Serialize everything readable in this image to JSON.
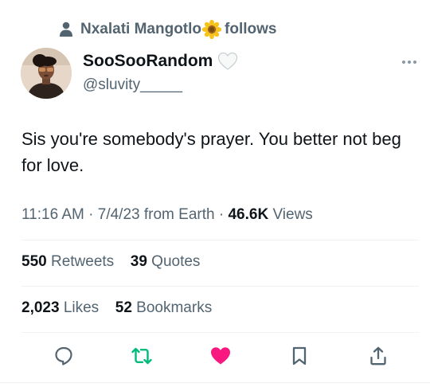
{
  "social_context": {
    "user_name": "Nxalati Mangotlo",
    "action": "follows",
    "icon": "person-icon",
    "emoji": "sunflower"
  },
  "author": {
    "display_name": "SooSooRandom",
    "handle": "@sluvity_____",
    "badge": "white-heart"
  },
  "tweet": {
    "text": "Sis you're somebody's prayer. You better not beg for love."
  },
  "meta": {
    "time": "11:16 AM",
    "date": "7/4/23",
    "source": "from Earth",
    "views_count": "46.6K",
    "views_label": "Views"
  },
  "stats": {
    "retweets_count": "550",
    "retweets_label": "Retweets",
    "quotes_count": "39",
    "quotes_label": "Quotes",
    "likes_count": "2,023",
    "likes_label": "Likes",
    "bookmarks_count": "52",
    "bookmarks_label": "Bookmarks"
  },
  "actions": [
    {
      "name": "reply",
      "icon": "reply-icon"
    },
    {
      "name": "retweet",
      "icon": "retweet-icon",
      "active_color": "#00ba7c"
    },
    {
      "name": "like",
      "icon": "heart-icon",
      "active_color": "#f91880"
    },
    {
      "name": "bookmark",
      "icon": "bookmark-icon"
    },
    {
      "name": "share",
      "icon": "share-icon"
    }
  ],
  "colors": {
    "text": "#0f1419",
    "secondary": "#536471",
    "divider": "#eff3f4"
  }
}
